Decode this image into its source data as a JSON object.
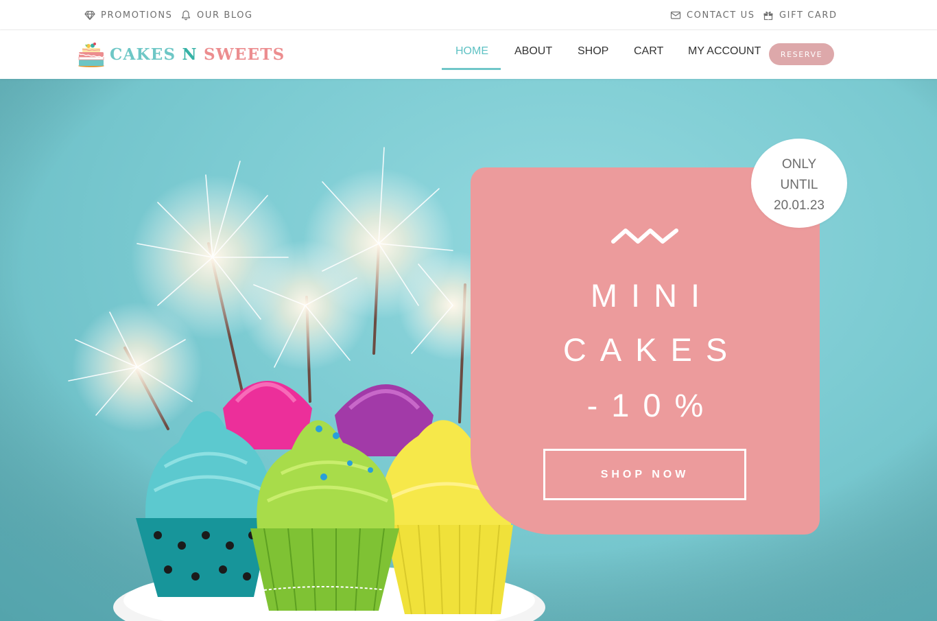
{
  "topbar": {
    "promotions": "PROMOTIONS",
    "blog": "OUR BLOG",
    "contact": "CONTACT US",
    "gift_card": "GIFT CARD"
  },
  "brand": {
    "part1": "CAKES",
    "part2": "N",
    "part3": "SWEETS"
  },
  "nav": {
    "home": "HOME",
    "about": "ABOUT",
    "shop": "SHOP",
    "cart": "CART",
    "account": "MY ACCOUNT",
    "reserve": "RESERVE",
    "active": "home"
  },
  "promo": {
    "line1": "MINI",
    "line2": "CAKES",
    "line3": "-10%",
    "cta": "SHOP NOW",
    "badge_line1": "ONLY",
    "badge_line2": "UNTIL",
    "badge_line3": "20.01.23"
  },
  "colors": {
    "accent_teal": "#6fc6c8",
    "accent_pink": "#ec9b9c",
    "reserve_button": "#dda8aa"
  },
  "icons": {
    "promotions": "diamond-icon",
    "blog": "bell-icon",
    "contact": "envelope-icon",
    "gift_card": "gift-icon"
  }
}
